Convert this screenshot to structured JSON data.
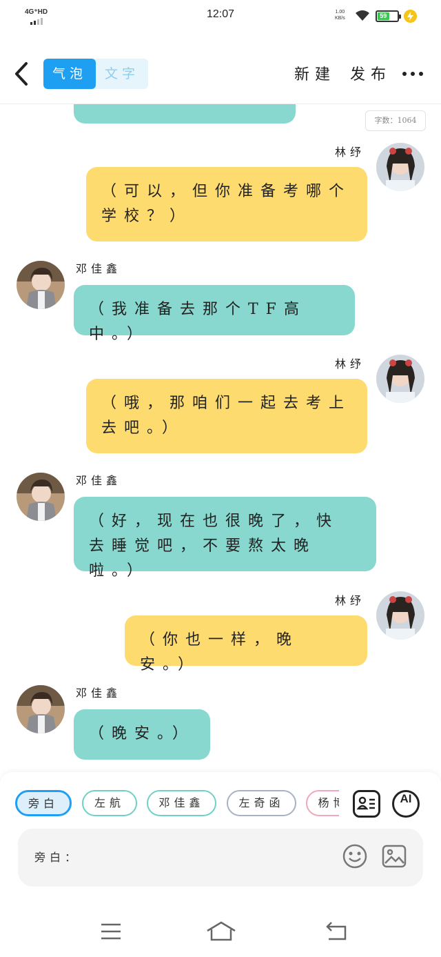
{
  "status": {
    "network": "4G⁺HD",
    "time": "12:07",
    "speed_value": "1.00",
    "speed_unit": "KB/s",
    "battery": "59",
    "battery_level": 0.59
  },
  "header": {
    "tabs": [
      {
        "label": "气泡",
        "active": true
      },
      {
        "label": "文字",
        "active": false
      }
    ],
    "new_label": "新建",
    "publish_label": "发布"
  },
  "chat": {
    "word_count": "字数：1064",
    "messages": [
      {
        "speaker": "",
        "text": ""
      },
      {
        "speaker": "林纾",
        "text": "（可以，但你准备考哪个学校？）"
      },
      {
        "speaker": "邓佳鑫",
        "text": "（我准备去那个TF高中。）"
      },
      {
        "speaker": "林纾",
        "text": "（哦，那咱们一起去考上去吧。）"
      },
      {
        "speaker": "邓佳鑫",
        "text": "（好，现在也很晚了，快去睡觉吧，不要熬太晚啦。）"
      },
      {
        "speaker": "林纾",
        "text": "（你也一样，晚安。）"
      },
      {
        "speaker": "邓佳鑫",
        "text": "（晚安。）"
      }
    ]
  },
  "composer": {
    "roles": [
      "旁白",
      "左航",
      "邓佳鑫",
      "左奇函",
      "杨博文"
    ],
    "ai_label": "AI",
    "input_placeholder": "旁白："
  },
  "colors": {
    "accent": "#1e9ff2",
    "teal_bubble": "#88d8cf",
    "yellow_bubble": "#fedb6f"
  },
  "icons": [
    "back-arrow-icon",
    "more-icon",
    "role-card-icon",
    "emoji-icon",
    "image-icon",
    "menu-icon",
    "home-icon",
    "back-nav-icon"
  ]
}
